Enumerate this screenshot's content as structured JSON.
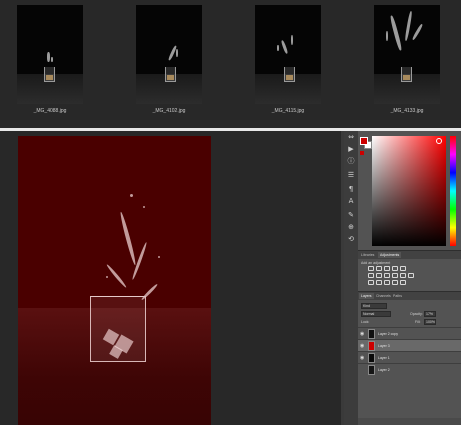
{
  "filmstrip": {
    "items": [
      {
        "label": "_MG_4088.jpg"
      },
      {
        "label": "_MG_4102.jpg"
      },
      {
        "label": "_MG_4115.jpg"
      },
      {
        "label": "_MG_4133.jpg"
      }
    ]
  },
  "tools": {
    "icons": [
      "move-icon",
      "play-icon",
      "info-icon",
      "properties-icon",
      "paragraph-icon",
      "character-icon",
      "brush-icon",
      "clone-source-icon",
      "history-icon"
    ]
  },
  "colors": {
    "foreground": "#cc0000",
    "background": "#ffffff",
    "canvas_overlay": "#4a0000"
  },
  "adjustments": {
    "tabs": [
      {
        "label": "Libraries"
      },
      {
        "label": "Adjustments"
      }
    ],
    "title": "Add an adjustment"
  },
  "layers": {
    "tabs": [
      {
        "label": "Layers"
      },
      {
        "label": "Channels"
      },
      {
        "label": "Paths"
      }
    ],
    "kind": "Kind",
    "blend_mode": "Normal",
    "opacity_label": "Opacity:",
    "opacity_value": "17%",
    "lock_label": "Lock:",
    "fill_label": "Fill:",
    "fill_value": "100%",
    "rows": [
      {
        "name": "Layer 2 copy"
      },
      {
        "name": "Layer 3"
      },
      {
        "name": "Layer 1"
      },
      {
        "name": "Layer 2"
      }
    ]
  }
}
